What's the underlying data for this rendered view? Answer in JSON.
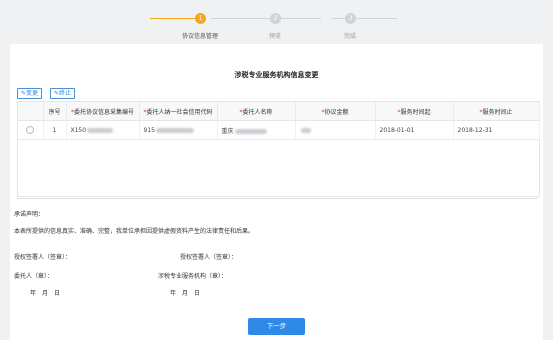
{
  "stepper": {
    "steps": [
      {
        "num": "1",
        "label": "协议信息管理",
        "active": true
      },
      {
        "num": "2",
        "label": "预览",
        "active": false
      },
      {
        "num": "3",
        "label": "完成",
        "active": false
      }
    ],
    "active_color": "#f5a623",
    "inactive_color": "#d0d3d8"
  },
  "panel": {
    "title": "涉税专业服务机构信息变更",
    "buttons": {
      "change": "变更",
      "stop": "终止"
    },
    "table": {
      "headers": [
        "",
        "序号",
        "委托协议信息采集编号",
        "委托人纳一社会信用代码",
        "委托人名称",
        "协议金额",
        "服务时间起",
        "服务时间止"
      ],
      "required": [
        false,
        false,
        true,
        true,
        true,
        true,
        true,
        true
      ],
      "rows": [
        {
          "index": "1",
          "agreement_no": "X150",
          "credit_code": "915",
          "client_name": "重庆",
          "amount": "",
          "start": "2018-01-01",
          "end": "2018-12-31"
        }
      ]
    },
    "statement": {
      "title": "承诺声明：",
      "text": "本表所提供的信息真实、准确、完整，我单位承担因提供虚假资料产生的法律责任和后果。",
      "signer_left": "授权签署人（签章）：",
      "signer_right": "授权签署人（签章）：",
      "client_seal": "委托人（章）：",
      "agency_seal": "涉税专业服务机构（章）：",
      "date_left": "年　月　日",
      "date_right": "年　月　日"
    },
    "next_label": "下一步"
  }
}
